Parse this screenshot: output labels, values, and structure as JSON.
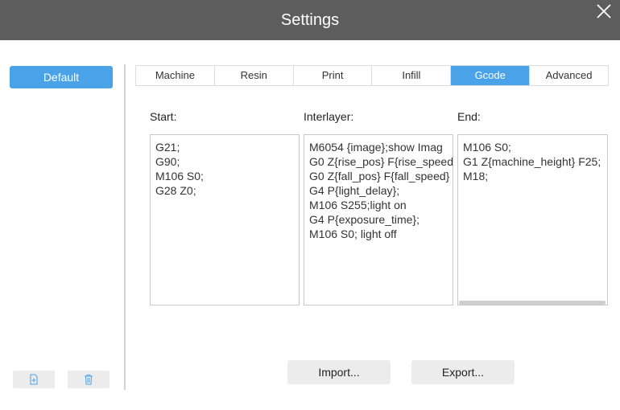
{
  "window": {
    "title": "Settings"
  },
  "sidebar": {
    "profile": "Default"
  },
  "tabs": [
    "Machine",
    "Resin",
    "Print",
    "Infill",
    "Gcode",
    "Advanced"
  ],
  "active_tab": "Gcode",
  "gcode": {
    "start_label": "Start:",
    "interlayer_label": "Interlayer:",
    "end_label": "End:",
    "start": "G21;\nG90;\nM106 S0;\nG28 Z0;",
    "interlayer": "M6054 {image};show Imag\nG0 Z{rise_pos} F{rise_speed\nG0 Z{fall_pos} F{fall_speed}\nG4 P{light_delay};\nM106 S255;light on\nG4 P{exposure_time};\nM106 S0; light off",
    "end": "M106 S0;\nG1 Z{machine_height} F25;\nM18;"
  },
  "buttons": {
    "import": "Import...",
    "export": "Export..."
  },
  "icons": {
    "close": "close-icon",
    "add": "add-file-icon",
    "delete": "trash-icon"
  },
  "colors": {
    "accent": "#4aa3e9",
    "titlebar": "#5d5d5d"
  }
}
